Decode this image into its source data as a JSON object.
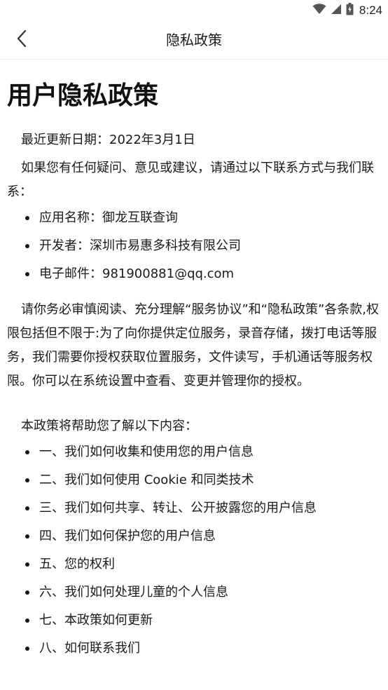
{
  "status_bar": {
    "time": "8:24",
    "icons": [
      "wifi-icon",
      "signal-icon",
      "battery-icon"
    ]
  },
  "app_bar": {
    "title": "隐私政策",
    "back_icon": "chevron-left-icon"
  },
  "document": {
    "title": "用户隐私政策",
    "updated": "最近更新日期：2022年3月1日",
    "contact_intro": "如果您有任何疑问、意见或建议，请通过以下联系方式与我们联系：",
    "contact_items": [
      "应用名称：御龙互联查询",
      "开发者：深圳市易惠多科技有限公司",
      "电子邮件：981900881@qq.com"
    ],
    "consent": "请你务必审慎阅读、充分理解“服务协议”和“隐私政策”各条款,权限包括但不限于:为了向你提供定位服务，录音存储，拨打电话等服务，我们需要你授权获取位置服务，文件读写，手机通话等服务权限。你可以在系统设置中查看、变更并管理你的授权。",
    "toc_intro": "本政策将帮助您了解以下内容：",
    "toc_items": [
      "一、我们如何收集和使用您的用户信息",
      "二、我们如何使用 Cookie 和同类技术",
      "三、我们如何共享、转让、公开披露您的用户信息",
      "四、我们如何保护您的用户信息",
      "五、您的权利",
      "六、我们如何处理儿童的个人信息",
      "七、本政策如何更新",
      "八、如何联系我们"
    ]
  },
  "colors": {
    "background": "#ffffff",
    "text": "#1a1a1a",
    "divider": "#ececec"
  }
}
